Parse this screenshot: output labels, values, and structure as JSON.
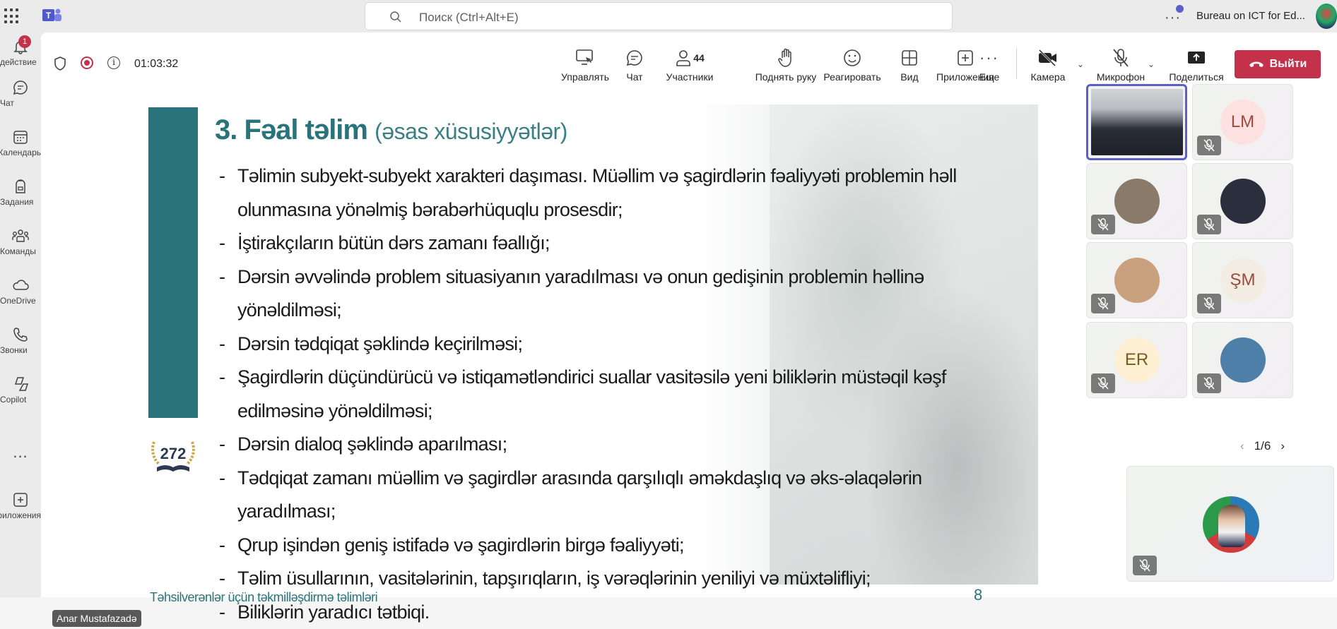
{
  "search": {
    "placeholder": "Поиск (Ctrl+Alt+E)"
  },
  "header": {
    "org_name": "Bureau on ICT for Ed..."
  },
  "rail": {
    "items": [
      {
        "label": "действие",
        "icon": "bell-icon",
        "badge": "1"
      },
      {
        "label": "Чат",
        "icon": "chat-icon"
      },
      {
        "label": "Календарь",
        "icon": "calendar-icon"
      },
      {
        "label": "Задания",
        "icon": "backpack-icon"
      },
      {
        "label": "Команды",
        "icon": "teams-icon"
      },
      {
        "label": "OneDrive",
        "icon": "cloud-icon"
      },
      {
        "label": "Звонки",
        "icon": "phone-icon"
      },
      {
        "label": "Copilot",
        "icon": "copilot-icon"
      },
      {
        "label": "...",
        "icon": "more-icon"
      },
      {
        "label": "Приложения",
        "icon": "add-app-icon"
      }
    ]
  },
  "meeting": {
    "timer": "01:03:32",
    "controls": {
      "manage": "Управлять",
      "chat": "Чат",
      "participants": "Участники",
      "participants_count": "44",
      "raise_hand": "Поднять руку",
      "react": "Реагировать",
      "view": "Вид",
      "apps": "Приложения",
      "more": "Еще",
      "camera": "Камера",
      "mic": "Микрофон",
      "share": "Поделиться",
      "leave": "Выйти"
    }
  },
  "slide": {
    "title": "3. Fəal təlim",
    "subtitle": "(əsas xüsusiyyətlər)",
    "logo_number": "272",
    "bullets": [
      "Təlimin subyekt-subyekt xarakteri daşıması. Müəllim və şagirdlərin fəaliyyəti problemin həll olunmasına yönəlmiş bərabərhüquqlu prosesdir;",
      "İştirakçıların bütün dərs zamanı fəallığı;",
      "Dərsin əvvəlində problem situasiyanın yaradılması və onun gedişinin problemin həllinə yönəldilməsi;",
      "Dərsin tədqiqat şəklində keçirilməsi;",
      "Şagirdlərin düçündürücü və istiqamətləndirici suallar vasitəsilə yeni biliklərin müstəqil kəşf edilməsinə yönəldilməsi;",
      "Dərsin dialoq şəklində aparılması;",
      "Tədqiqat zamanı müəllim və şagirdlər arasında qarşılıqlı əməkdaşlıq və əks-əlaqələrin yaradılması;",
      "Qrup işindən geniş istifadə və şagirdlərin birgə fəaliyyəti;",
      "Təlim üsullarının, vasitələrinin, tapşırıqların, iş vərəqlərinin yeniliyi və müxtəlifliyi;",
      "Biliklərin yaradıcı tətbiqi."
    ],
    "footer": "Təhsilverənlər üçün təkmilləşdirmə təlimləri",
    "page": "8"
  },
  "speaker": {
    "name": "Anar Mustafazadə"
  },
  "gallery": {
    "tiles": [
      {
        "initials": "",
        "color": "#3a3f4a"
      },
      {
        "initials": "LM",
        "color": "#fde1e1"
      },
      {
        "initials": "",
        "color": "#8a7a6a"
      },
      {
        "initials": "",
        "color": "#2b2f3d"
      },
      {
        "initials": "",
        "color": "#c9a17f"
      },
      {
        "initials": "ŞM",
        "color": "#f3ece2"
      },
      {
        "initials": "ER",
        "color": "#fdf0d2"
      },
      {
        "initials": "",
        "color": "#4d7fa8"
      }
    ],
    "page": "1/6"
  },
  "colors": {
    "accent": "#5b5fc7",
    "leave": "#c4314b",
    "slide_teal": "#2a737b"
  }
}
